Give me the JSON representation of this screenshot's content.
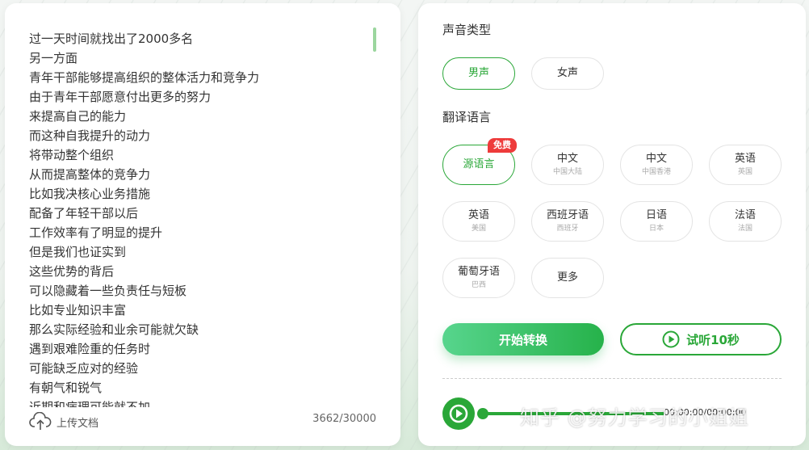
{
  "editor": {
    "lines": [
      "过一天时间就找出了2000多名",
      "另一方面",
      "青年干部能够提高组织的整体活力和竞争力",
      "由于青年干部愿意付出更多的努力",
      "来提高自己的能力",
      "而这种自我提升的动力",
      "将带动整个组织",
      "从而提高整体的竞争力",
      "比如我决核心业务措施",
      "配备了年轻干部以后",
      "工作效率有了明显的提升",
      "但是我们也证实到",
      "这些优势的背后",
      "可以隐藏着一些负责任与短板",
      "比如专业知识丰富",
      "那么实际经验和业余可能就欠缺",
      "遇到艰难险重的任务时",
      "可能缺乏应对的经验",
      "有朝气和锐气",
      "近期和病理可能就不加"
    ],
    "upload_label": "上传文档",
    "char_count": "3662/30000"
  },
  "voice": {
    "title": "声音类型",
    "options": [
      {
        "label": "男声",
        "active": true
      },
      {
        "label": "女声",
        "active": false
      }
    ]
  },
  "language": {
    "title": "翻译语言",
    "free_badge": "免费",
    "options": [
      {
        "label": "源语言",
        "sub": "",
        "active": true
      },
      {
        "label": "中文",
        "sub": "中国大陆",
        "active": false
      },
      {
        "label": "中文",
        "sub": "中国香港",
        "active": false
      },
      {
        "label": "英语",
        "sub": "英国",
        "active": false
      },
      {
        "label": "英语",
        "sub": "美国",
        "active": false
      },
      {
        "label": "西班牙语",
        "sub": "西班牙",
        "active": false
      },
      {
        "label": "日语",
        "sub": "日本",
        "active": false
      },
      {
        "label": "法语",
        "sub": "法国",
        "active": false
      },
      {
        "label": "葡萄牙语",
        "sub": "巴西",
        "active": false
      },
      {
        "label": "更多",
        "sub": "",
        "active": false
      }
    ]
  },
  "actions": {
    "start_label": "开始转换",
    "listen_label": "试听10秒"
  },
  "player": {
    "time": "00:00:00/00:00:00"
  },
  "watermark": "知乎 @努力学习的小姐姐",
  "colors": {
    "accent": "#2aa738",
    "badge": "#ee3b3b"
  }
}
